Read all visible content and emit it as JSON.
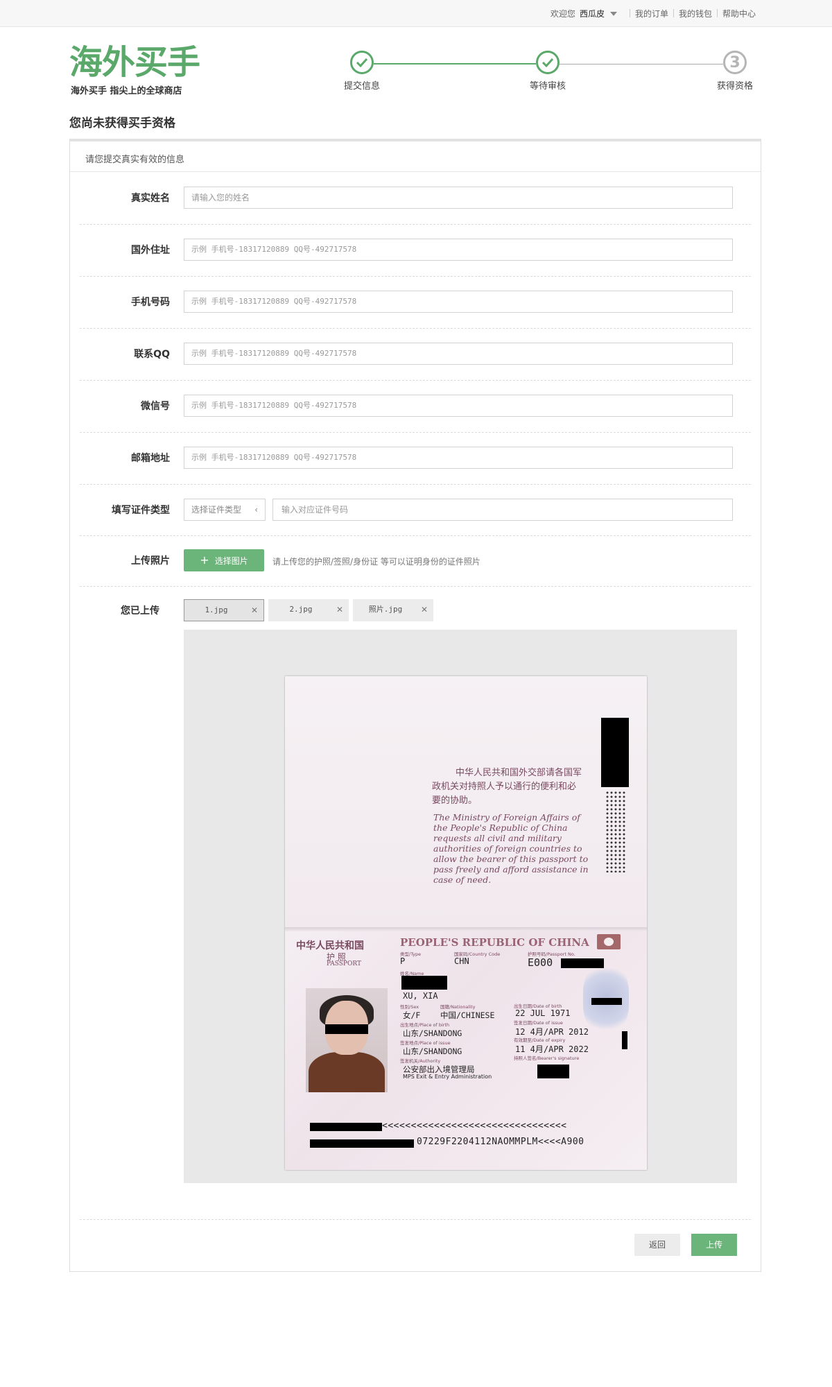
{
  "topbar": {
    "welcome": "欢迎您",
    "username": "西瓜皮",
    "links": [
      "我的订单",
      "我的钱包",
      "帮助中心"
    ]
  },
  "logo": {
    "main": "海外买手",
    "sub": "海外买手 指尖上的全球商店"
  },
  "steps": [
    {
      "label": "提交信息",
      "status": "done"
    },
    {
      "label": "等待审核",
      "status": "done"
    },
    {
      "label": "获得资格",
      "status": "todo",
      "number": "3"
    }
  ],
  "page_title": "您尚未获得买手资格",
  "panel": {
    "heading": "请您提交真实有效的信息"
  },
  "form": {
    "real_name": {
      "label": "真实姓名",
      "placeholder": "请输入您的姓名"
    },
    "address": {
      "label": "国外住址",
      "placeholder": "示例 手机号-18317120889  QQ号-492717578"
    },
    "phone": {
      "label": "手机号码",
      "placeholder": "示例 手机号-18317120889  QQ号-492717578"
    },
    "qq": {
      "label": "联系QQ",
      "placeholder": "示例 手机号-18317120889  QQ号-492717578"
    },
    "wechat": {
      "label": "微信号",
      "placeholder": "示例 手机号-18317120889  QQ号-492717578"
    },
    "email": {
      "label": "邮箱地址",
      "placeholder": "示例 手机号-18317120889  QQ号-492717578"
    },
    "id_type": {
      "label": "填写证件类型",
      "select_placeholder": "选择证件类型",
      "number_placeholder": "输入对应证件号码"
    },
    "photo": {
      "label": "上传照片",
      "button": "选择图片",
      "hint": "请上传您的护照/签照/身份证 等可以证明身份的证件照片"
    },
    "uploaded": {
      "label": "您已上传",
      "files": [
        "1.jpg",
        "2.jpg",
        "照片.jpg"
      ]
    }
  },
  "passport": {
    "cn_request": [
      "中华人民共和国外交部请各国军",
      "政机关对持照人予以通行的便利和必",
      "要的协助。"
    ],
    "en_request": [
      "The  Ministry  of  Foreign  Affairs  of",
      "the  People's  Republic  of  China",
      "requests  all  civil  and  military",
      "authorities  of  foreign  countries  to",
      "allow  the  bearer  of  this  passport  to",
      "pass freely and afford assistance in",
      "case of need."
    ],
    "country_cn": "中华人民共和国",
    "country_en": "PEOPLE'S REPUBLIC OF CHINA",
    "passport_cn": "护  照",
    "passport_en": "PASSPORT",
    "type_label": "类型/Type",
    "type": "P",
    "code_label": "国家码/Country Code",
    "code": "CHN",
    "no_label": "护照号码/Passport No.",
    "no": "E000",
    "name_label": "姓名/Name",
    "name": "XU, XIA",
    "sex_label": "性别/Sex",
    "sex": "女/F",
    "nationality_label": "国籍/Nationality",
    "nationality": "中国/CHINESE",
    "dob_label": "出生日期/Date of birth",
    "dob": "22 JUL 1971",
    "pob_label": "出生地点/Place of birth",
    "pob": "山东/SHANDONG",
    "issue_date_label": "签发日期/Date of issue",
    "issue_date": "12 4月/APR 2012",
    "poi_label": "签发地点/Place of issue",
    "poi": "山东/SHANDONG",
    "expiry_label": "有效期至/Date of expiry",
    "expiry": "11 4月/APR 2022",
    "authority_label": "签发机关/Authority",
    "authority_cn": "公安部出入境管理局",
    "authority_en": "MPS Exit & Entry Administration",
    "signature_label": "持照人签名/Bearer's signature",
    "mrz1": "<<<<<<<<<<<<<<<<<<<<<<<<<<<<<<<<",
    "mrz2": "07229F2204112NAOMMPLM<<<<A900"
  },
  "actions": {
    "back": "返回",
    "upload": "上传"
  },
  "colors": {
    "accent": "#6bb47a",
    "logo": "#5aa86a"
  }
}
